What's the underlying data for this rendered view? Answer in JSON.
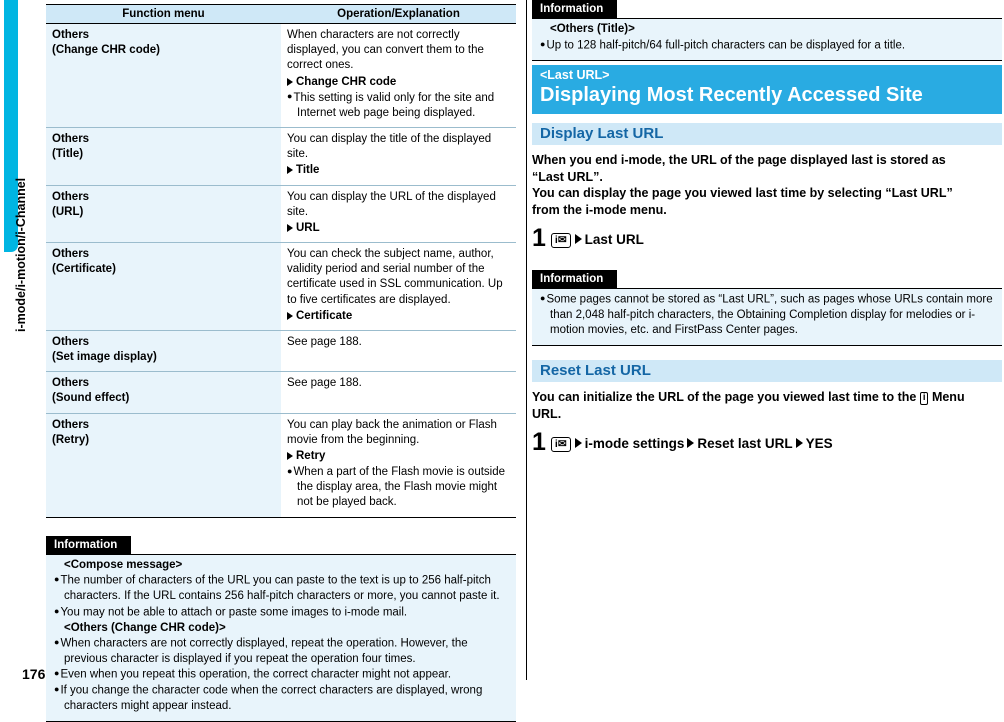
{
  "sidebar": {
    "vertical_label": "i-mode/i-motion/i-Channel",
    "page_number": "176"
  },
  "function_table": {
    "headers": [
      "Function menu",
      "Operation/Explanation"
    ],
    "rows": [
      {
        "menu_line1": "Others",
        "menu_line2": "(Change CHR code)",
        "exp_text": "When characters are not correctly displayed, you can convert them to the correct ones.",
        "exp_action": "Change CHR code",
        "bullets": [
          "This setting is valid only for the site and Internet web page being displayed."
        ]
      },
      {
        "menu_line1": "Others",
        "menu_line2": "(Title)",
        "exp_text": "You can display the title of the displayed site.",
        "exp_action": "Title",
        "bullets": []
      },
      {
        "menu_line1": "Others",
        "menu_line2": "(URL)",
        "exp_text": "You can display the URL of the displayed site.",
        "exp_action": "URL",
        "bullets": []
      },
      {
        "menu_line1": "Others",
        "menu_line2": "(Certificate)",
        "exp_text": "You can check the subject name, author, validity period and serial number of the certificate used in SSL communication. Up to five certificates are displayed.",
        "exp_action": "Certificate",
        "bullets": []
      },
      {
        "menu_line1": "Others",
        "menu_line2": "(Set image display)",
        "exp_text": "See page 188.",
        "exp_action": "",
        "bullets": []
      },
      {
        "menu_line1": "Others",
        "menu_line2": "(Sound effect)",
        "exp_text": "See page 188.",
        "exp_action": "",
        "bullets": []
      },
      {
        "menu_line1": "Others",
        "menu_line2": "(Retry)",
        "exp_text": "You can play back the animation or Flash movie from the beginning.",
        "exp_action": "Retry",
        "bullets": [
          "When a part of the Flash movie is outside the display area, the Flash movie might not be played back."
        ]
      }
    ]
  },
  "left_information": {
    "title": "Information",
    "heading1": "<Compose message>",
    "items1": [
      "The number of characters of the URL you can paste to the text is up to 256 half-pitch characters. If the URL contains 256 half-pitch characters or more, you cannot paste it.",
      "You may not be able to attach or paste some images to i-mode mail."
    ],
    "heading2": "<Others (Change CHR code)>",
    "items2": [
      "When characters are not correctly displayed, repeat the operation. However, the previous character is displayed if you repeat the operation four times.",
      "Even when you repeat this operation, the correct character might not appear.",
      "If you change the character code when the correct characters are displayed, wrong characters might appear instead."
    ]
  },
  "right_information_top": {
    "title": "Information",
    "heading": "<Others (Title)>",
    "items": [
      "Up to 128 half-pitch/64 full-pitch characters can be displayed for a title."
    ]
  },
  "chapter": {
    "tag": "<Last URL>",
    "title": "Displaying Most Recently Accessed Site"
  },
  "section1": {
    "title": "Display Last URL",
    "lead_line1": "When you end i-mode, the URL of the page displayed last is stored as",
    "lead_line2": "“Last URL”.",
    "lead_line3": "You can display the page you viewed last time by selecting “Last URL”",
    "lead_line4": "from the i-mode menu.",
    "step_number": "1",
    "step_key": "i✉",
    "step_text": "Last URL"
  },
  "right_information_mid": {
    "title": "Information",
    "items": [
      "Some pages cannot be stored as “Last URL”, such as pages whose URLs contain more than 2,048 half-pitch characters, the Obtaining Completion display for melodies or i-motion movies, etc. and FirstPass Center pages."
    ]
  },
  "section2": {
    "title": "Reset Last URL",
    "lead_line1": "You can initialize the URL of the page you viewed last time to the",
    "lead_menu_icon": "i",
    "lead_line1b": "Menu",
    "lead_line2": "URL.",
    "step_number": "1",
    "step_key": "i✉",
    "step_item1": "i-mode settings",
    "step_item2": "Reset last URL",
    "step_item3": "YES"
  },
  "colors": {
    "accent_cyan": "#29abe2",
    "band_light": "#cfe8f7",
    "cell_light": "#e8f4fb",
    "section_text": "#1466a5"
  }
}
